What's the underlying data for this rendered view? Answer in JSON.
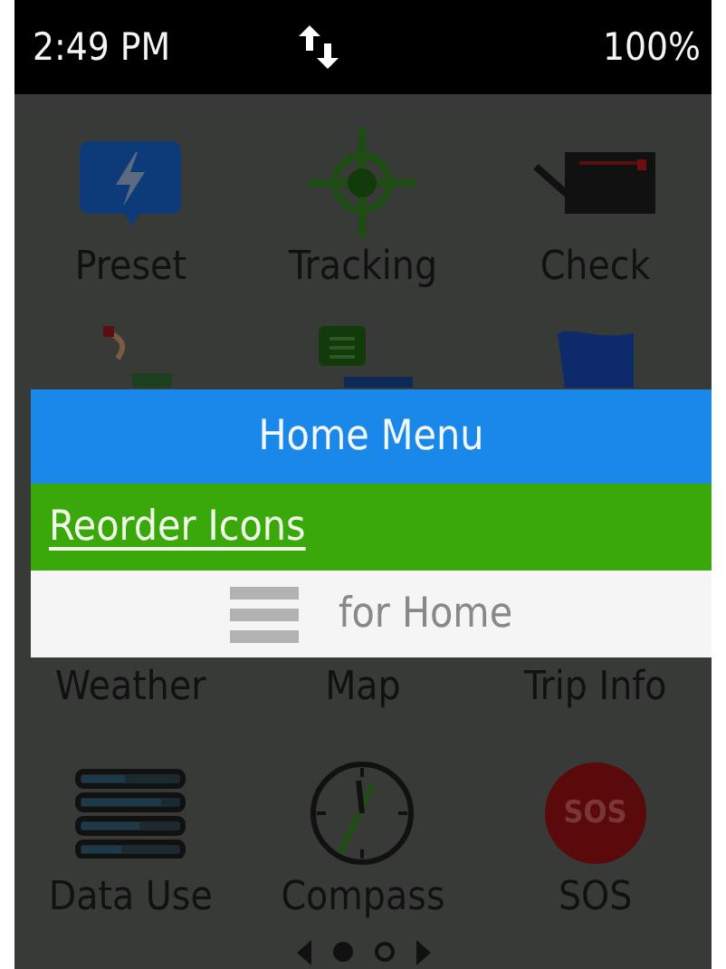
{
  "status_bar": {
    "time": "2:49 PM",
    "battery": "100%"
  },
  "app_rows": [
    [
      {
        "label": "Preset",
        "kind": "preset"
      },
      {
        "label": "Tracking",
        "kind": "tracking"
      },
      {
        "label": "Check",
        "kind": "check"
      }
    ],
    [
      {
        "kind": "route"
      },
      {
        "kind": "message"
      },
      {
        "kind": "flag"
      }
    ],
    [
      {
        "label": "Weather"
      },
      {
        "label": "Map"
      },
      {
        "label": "Trip Info"
      }
    ],
    [
      {
        "label": "Data Use",
        "kind": "data"
      },
      {
        "label": "Compass",
        "kind": "compass"
      },
      {
        "label": "SOS",
        "kind": "sos",
        "badge": "SOS"
      }
    ]
  ],
  "menu": {
    "title": "Home Menu",
    "items": [
      {
        "label": "Reorder Icons",
        "selected": true
      },
      {
        "label": "for Home",
        "selected": false
      }
    ]
  },
  "pager": [
    {
      "selected": true
    },
    {
      "selected": false
    }
  ]
}
